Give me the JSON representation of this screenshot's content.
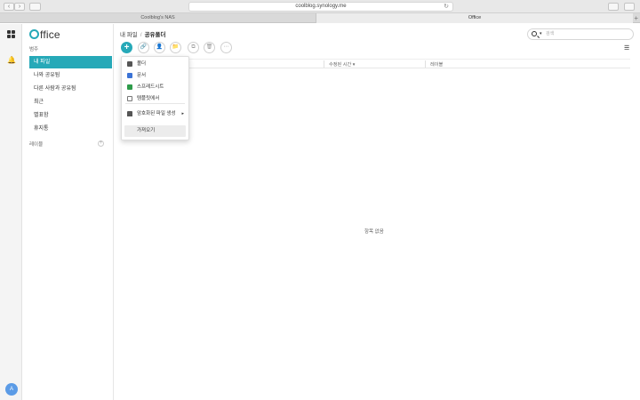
{
  "browser": {
    "url": "coolblog.synology.me",
    "tabs": [
      "Coolblog's NAS",
      "Office"
    ],
    "back": "‹",
    "forward": "›",
    "reload": "↻",
    "new_tab": "+"
  },
  "rail": {
    "avatar_letter": "A"
  },
  "app": {
    "logo_rest": "ffice"
  },
  "sidebar": {
    "category_label": "범주",
    "items": [
      {
        "label": "내 파일",
        "active": true
      },
      {
        "label": "나와 공유됨",
        "active": false
      },
      {
        "label": "다른 사람과 공유됨",
        "active": false
      },
      {
        "label": "최근",
        "active": false
      },
      {
        "label": "별표함",
        "active": false
      },
      {
        "label": "휴지통",
        "active": false
      }
    ],
    "labels_heading": "레이블",
    "labels_add": "+"
  },
  "breadcrumb": {
    "parent": "내 파일",
    "separator": "/",
    "current": "공유폴더"
  },
  "search": {
    "placeholder": "검색"
  },
  "toolbar": {
    "add": "+"
  },
  "columns": {
    "modified": "수정된 시간",
    "sort_arrow": "▾",
    "label": "레이블"
  },
  "empty_text": "항목 없음",
  "menu": {
    "items": [
      {
        "label": "폴더",
        "icon": "folder-icon",
        "color": "#555555"
      },
      {
        "label": "문서",
        "icon": "document-icon",
        "color": "#3b73d6"
      },
      {
        "label": "스프레드시트",
        "icon": "spreadsheet-icon",
        "color": "#2e9b4a"
      },
      {
        "label": "템플릿에서",
        "icon": "template-icon",
        "color": "#777777"
      }
    ],
    "encrypted": {
      "label": "암호화된 파일 생성",
      "icon": "lock-icon",
      "arrow": "▸"
    },
    "import": "가져오기"
  },
  "colors": {
    "accent": "#26a9b8"
  }
}
